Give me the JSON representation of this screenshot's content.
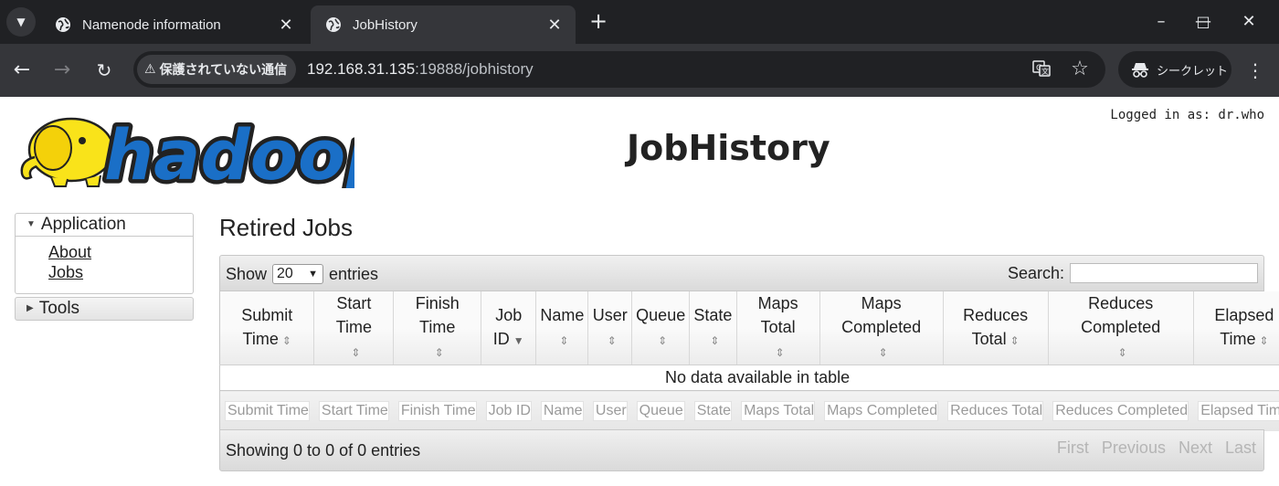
{
  "browser": {
    "tabs": [
      {
        "title": "Namenode information",
        "active": false
      },
      {
        "title": "JobHistory",
        "active": true
      }
    ],
    "security_label": "保護されていない通信",
    "url_host": "192.168.31.135",
    "url_path": ":19888/jobhistory",
    "incognito_label": "シークレット"
  },
  "page": {
    "title": "JobHistory",
    "logged_in": "Logged in as: dr.who",
    "logo_text": "hadoop"
  },
  "nav": {
    "application": "Application",
    "links": [
      "About",
      "Jobs"
    ],
    "tools": "Tools"
  },
  "table": {
    "section_title": "Retired Jobs",
    "show_label": "Show",
    "page_length": "20",
    "entries_label": "entries",
    "search_label": "Search:",
    "columns": [
      {
        "label": "Submit Time",
        "filter": "Submit Time",
        "sort": "both"
      },
      {
        "label": "Start Time",
        "filter": "Start Time",
        "sort": "both"
      },
      {
        "label": "Finish Time",
        "filter": "Finish Time",
        "sort": "both"
      },
      {
        "label": "Job ID",
        "filter": "Job ID",
        "sort": "desc"
      },
      {
        "label": "Name",
        "filter": "Name",
        "sort": "both"
      },
      {
        "label": "User",
        "filter": "User",
        "sort": "both"
      },
      {
        "label": "Queue",
        "filter": "Queue",
        "sort": "both"
      },
      {
        "label": "State",
        "filter": "State",
        "sort": "both"
      },
      {
        "label": "Maps Total",
        "filter": "Maps Total",
        "sort": "both"
      },
      {
        "label": "Maps Completed",
        "filter": "Maps Completed",
        "sort": "both"
      },
      {
        "label": "Reduces Total",
        "filter": "Reduces Total",
        "sort": "both"
      },
      {
        "label": "Reduces Completed",
        "filter": "Reduces Completed",
        "sort": "both"
      },
      {
        "label": "Elapsed Time",
        "filter": "Elapsed Time",
        "sort": "both"
      }
    ],
    "empty_message": "No data available in table",
    "info": "Showing 0 to 0 of 0 entries",
    "paging": [
      "First",
      "Previous",
      "Next",
      "Last"
    ]
  }
}
